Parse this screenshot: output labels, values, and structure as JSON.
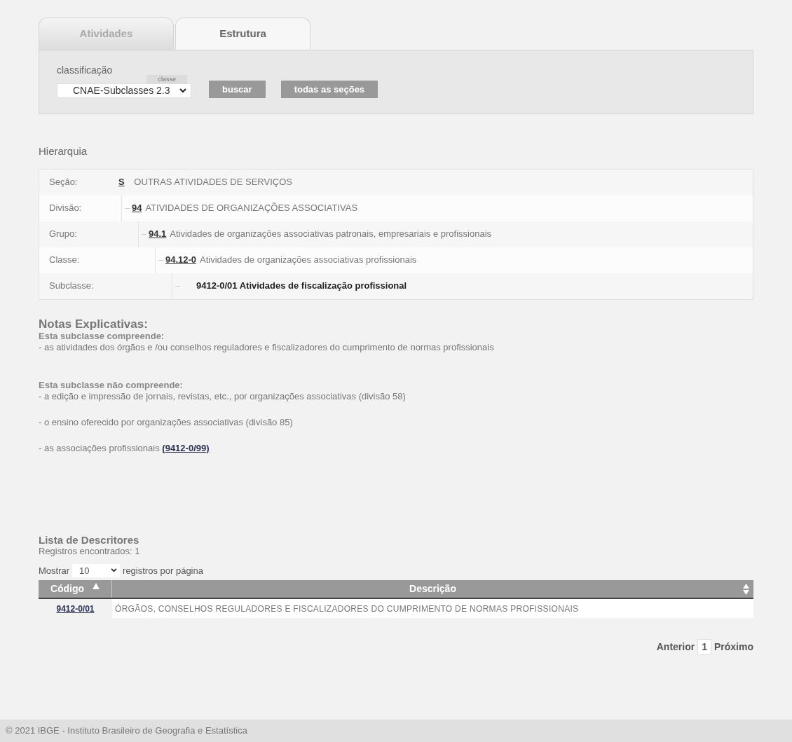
{
  "tabs": [
    {
      "label": "Atividades",
      "selected": false
    },
    {
      "label": "Estrutura",
      "selected": true
    }
  ],
  "search": {
    "label": "classificação",
    "hint_tab": "classe",
    "select_value": "CNAE-Subclasses 2.3",
    "buttons": [
      "buscar",
      "todas as seções"
    ]
  },
  "hierarchy": {
    "title": "Hierarquia",
    "root": {
      "label": "Seção:",
      "code": "S",
      "text": "OUTRAS ATIVIDADES DE SERVIÇOS",
      "current": false,
      "children": [
        {
          "label": "Divisão:",
          "code": "94",
          "text": "ATIVIDADES DE ORGANIZAÇÕES ASSOCIATIVAS",
          "current": false,
          "children": [
            {
              "label": "Grupo:",
              "code": "94.1",
              "text": "Atividades de organizações associativas patronais, empresariais e profissionais",
              "current": false,
              "children": [
                {
                  "label": "Classe:",
                  "code": "94.12-0",
                  "text": "Atividades de organizações associativas profissionais",
                  "current": false,
                  "children": [
                    {
                      "label": "Subclasse:",
                      "code": "9412-0/01",
                      "text": "Atividades de fiscalização profissional",
                      "current": true
                    }
                  ]
                }
              ]
            }
          ]
        }
      ]
    }
  },
  "notes": {
    "title": "Notas Explicativas:",
    "sections": [
      {
        "title": "Esta subclasse compreende:",
        "items": [
          {
            "text": "- as atividades dos órgãos e /ou conselhos reguladores e fiscalizadores do cumprimento de normas profissionais"
          }
        ]
      },
      {
        "title": "Esta subclasse não compreende:",
        "items": [
          {
            "text": "- a edição e impressão de jornais, revistas, etc., por organizações associativas (divisão 58)"
          },
          {
            "text": "- o ensino oferecido por organizações associativas (divisão 85)"
          },
          {
            "text": "- as associações profissionais",
            "link": "(9412-0/99)"
          }
        ]
      }
    ]
  },
  "descriptors": {
    "title": "Lista de Descritores",
    "count": "Registros encontrados: 1",
    "show_label": "Mostrar",
    "page_size": "10",
    "show_suffix": "registros por página",
    "columns": [
      {
        "label": "Código",
        "sorted": true
      },
      {
        "label": "Descrição",
        "sorted": false
      }
    ],
    "rows": [
      {
        "code": "9412-0/01",
        "description": "ÓRGÃOS, CONSELHOS REGULADORES E FISCALIZADORES DO CUMPRIMENTO DE NORMAS PROFISSIONAIS"
      }
    ],
    "pagination": {
      "previous": "Anterior",
      "pages": [
        {
          "label": "1",
          "selected": true
        }
      ],
      "next": "Próximo"
    }
  },
  "footer": "© 2021 IBGE - Instituto Brasileiro de Geografia e Estatística"
}
